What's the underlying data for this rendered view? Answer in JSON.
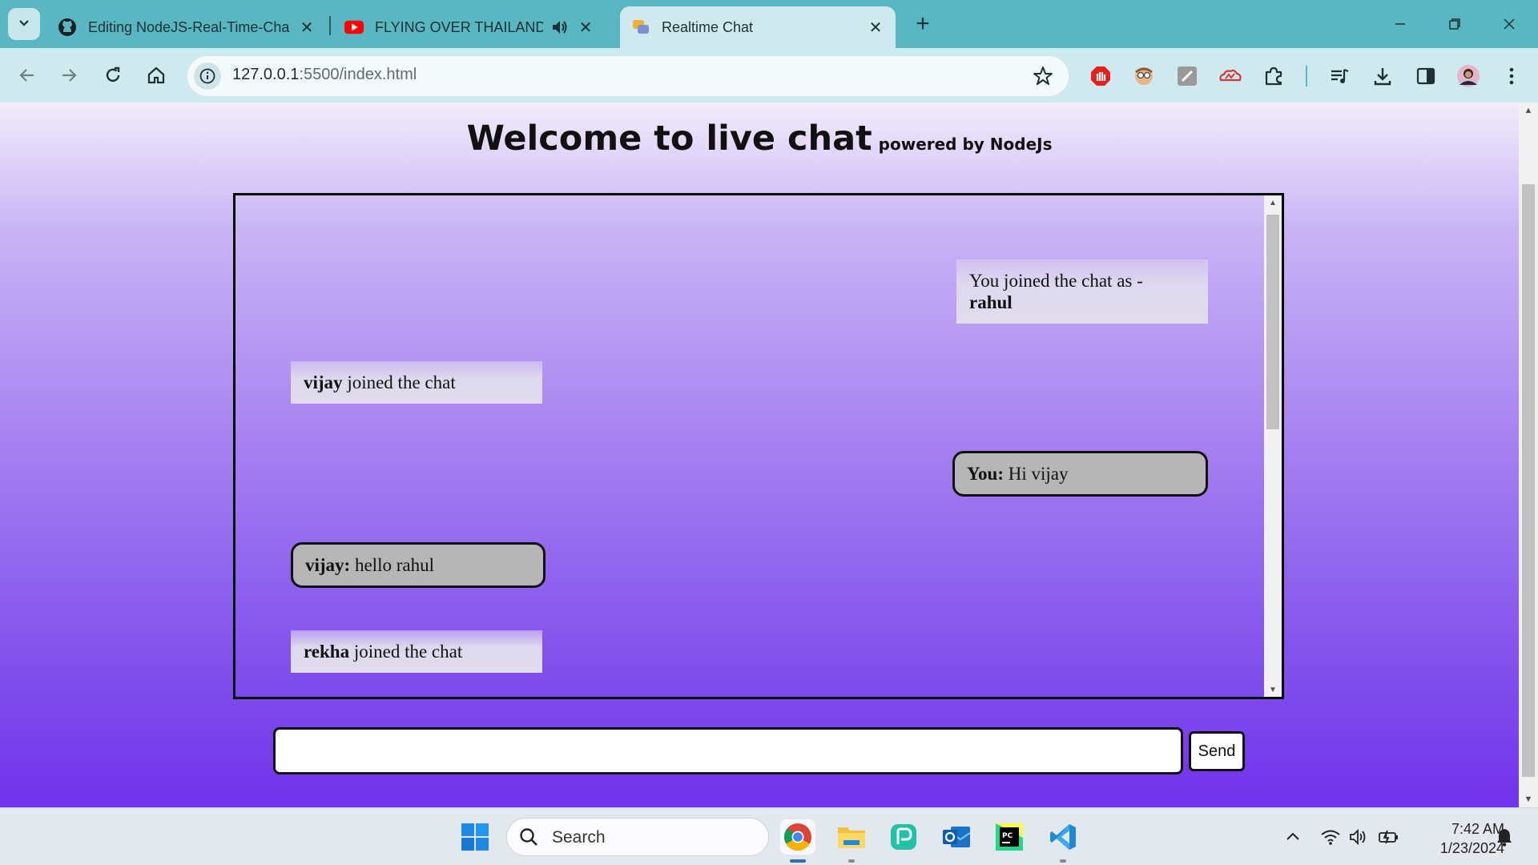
{
  "browser": {
    "tabs": [
      {
        "title": "Editing NodeJS-Real-Time-Chat",
        "icon": "github-icon",
        "active": false
      },
      {
        "title": "FLYING OVER THAILAND - F",
        "icon": "youtube-icon",
        "active": false,
        "audio": "speaker-icon"
      },
      {
        "title": "Realtime Chat",
        "icon": "chat-favicon",
        "active": true
      }
    ],
    "address": {
      "host": "127.0.0.1",
      "rest": ":5500/index.html"
    },
    "accent": "#58b7c1",
    "toolbar_color": "#cfeaee"
  },
  "page": {
    "title": "Welcome to live chat",
    "subtitle": "powered by NodeJs",
    "messages": [
      {
        "type": "notice",
        "side": "right",
        "prefix": "You joined the chat as -",
        "name": "rahul"
      },
      {
        "type": "notice",
        "side": "left",
        "name": "vijay",
        "text": " joined the chat"
      },
      {
        "type": "bubble",
        "side": "right",
        "name": "You:",
        "text": " Hi vijay"
      },
      {
        "type": "bubble",
        "side": "left",
        "name": "vijay:",
        "text": " hello rahul"
      },
      {
        "type": "notice",
        "side": "left",
        "name": "rekha",
        "text": " joined the chat"
      }
    ],
    "input_value": "",
    "send_label": "Send",
    "bubble_color": "#b6b6b6",
    "gradient_top": "#f2ecfb",
    "gradient_bottom": "#7233ec"
  },
  "taskbar": {
    "search_label": "Search",
    "time": "7:42 AM",
    "date": "1/23/2024",
    "apps": [
      "windows-start-icon",
      "chrome-icon",
      "file-explorer-icon",
      "pycharm-edu-icon",
      "outlook-icon",
      "pycharm-icon",
      "vscode-icon"
    ]
  }
}
